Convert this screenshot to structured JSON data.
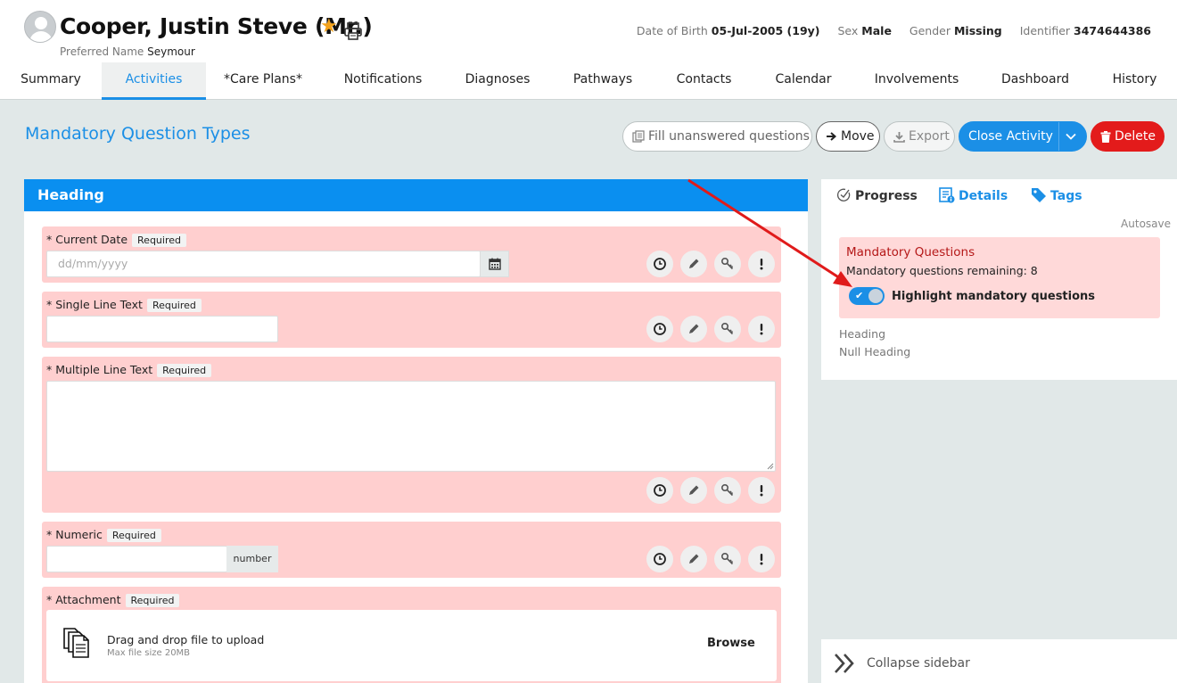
{
  "patient": {
    "name": "Cooper, Justin Steve (Mr.)",
    "preferred_label": "Preferred Name",
    "preferred_value": "Seymour",
    "dob_label": "Date of Birth",
    "dob_value": "05-Jul-2005 (19y)",
    "sex_label": "Sex",
    "sex_value": "Male",
    "gender_label": "Gender",
    "gender_value": "Missing",
    "identifier_label": "Identifier",
    "identifier_value": "3474644386"
  },
  "nav": {
    "tabs": [
      {
        "label": "Summary"
      },
      {
        "label": "Activities"
      },
      {
        "label": "*Care Plans*"
      },
      {
        "label": "Notifications"
      },
      {
        "label": "Diagnoses"
      },
      {
        "label": "Pathways"
      },
      {
        "label": "Contacts"
      },
      {
        "label": "Calendar"
      },
      {
        "label": "Involvements"
      },
      {
        "label": "Dashboard"
      },
      {
        "label": "History"
      }
    ],
    "active": "Activities"
  },
  "page": {
    "title": "Mandatory Question Types"
  },
  "actions": {
    "fill": "Fill unanswered questions",
    "move": "Move",
    "export": "Export",
    "close": "Close Activity",
    "delete": "Delete"
  },
  "form": {
    "heading": "Heading",
    "required_tag": "Required",
    "questions": [
      {
        "label": "* Current Date",
        "placeholder": "dd/mm/yyyy"
      },
      {
        "label": "* Single Line Text"
      },
      {
        "label": "* Multiple Line Text"
      },
      {
        "label": "* Numeric",
        "addon": "number"
      },
      {
        "label": "* Attachment",
        "drop_text": "Drag and drop file to upload",
        "max_size": "Max file size 20MB",
        "browse": "Browse"
      }
    ]
  },
  "sidebar": {
    "tabs": {
      "progress": "Progress",
      "details": "Details",
      "tags": "Tags"
    },
    "autosave": "Autosave",
    "mandatory_title": "Mandatory Questions",
    "mandatory_remaining": "Mandatory questions remaining: 8",
    "highlight_label": "Highlight mandatory questions",
    "highlight_on": true,
    "outline": [
      "Heading",
      "Null Heading"
    ],
    "collapse": "Collapse sidebar"
  },
  "colors": {
    "accent": "#1b8fe6",
    "required_bg": "#ffcfcf",
    "delete": "#e31b1b",
    "star": "#f3a21b"
  },
  "icons": [
    "avatar-icon",
    "star-icon",
    "printer-icon",
    "fill-copy-icon",
    "arrow-right-icon",
    "download-icon",
    "chevron-down-icon",
    "trash-icon",
    "calendar-icon",
    "clock-icon",
    "pencil-icon",
    "key-icon",
    "exclamation-icon",
    "file-stack-icon",
    "progress-check-icon",
    "details-icon",
    "tag-icon",
    "double-chevron-icon",
    "annotation-arrow"
  ]
}
